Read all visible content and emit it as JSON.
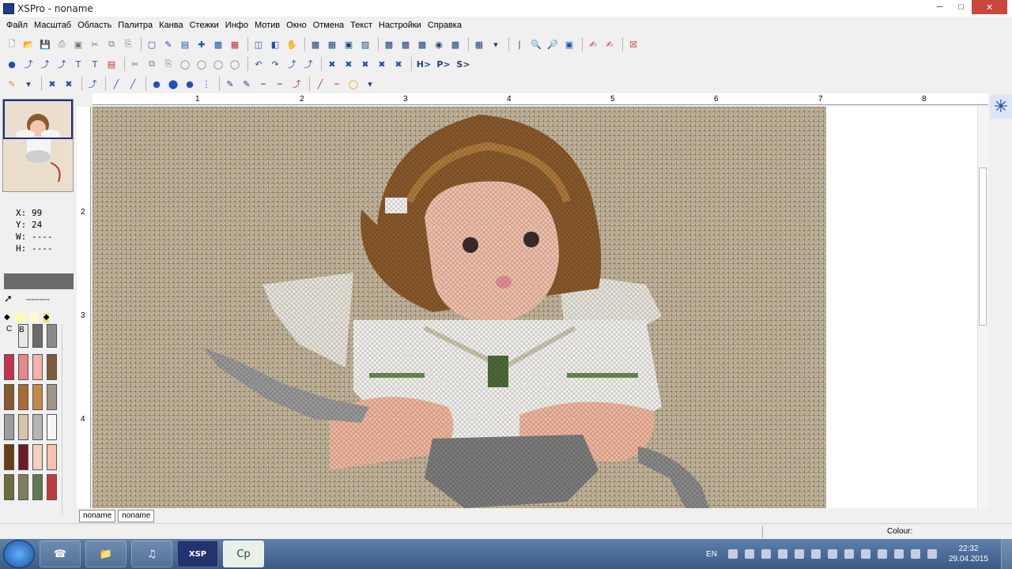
{
  "window": {
    "title": "XSPro - noname"
  },
  "menu": [
    "Файл",
    "Масштаб",
    "Область",
    "Палитра",
    "Канва",
    "Стежки",
    "Инфо",
    "Мотив",
    "Окно",
    "Отмена",
    "Текст",
    "Настройки",
    "Справка"
  ],
  "toolbar_row3": {
    "h_label": "H>",
    "p_label": "P>",
    "s_label": "S>"
  },
  "coords": {
    "x_label": "X:",
    "x_value": "99",
    "y_label": "Y:",
    "y_value": "24",
    "w_label": "W:",
    "w_value": "----",
    "h_label": "H:",
    "h_value": "----"
  },
  "panel": {
    "line_label": "---------",
    "c_label": "C",
    "b_label": "B"
  },
  "ruler_h": [
    "1",
    "2",
    "3",
    "4",
    "5",
    "6",
    "7",
    "8"
  ],
  "ruler_v": [
    "2",
    "3",
    "4"
  ],
  "tabs": [
    "noname",
    "noname"
  ],
  "status": {
    "colour_label": "Colour:"
  },
  "taskbar": {
    "lang": "EN",
    "time": "22:32",
    "date": "29.04.2015",
    "cp_label": "Cp",
    "xsp_label": "XSP"
  },
  "colors": {
    "fabric": "#cdbfa5",
    "hair": "#8b5a2b",
    "skin": "#f2b9a3",
    "accent": "#1c3aa8"
  }
}
